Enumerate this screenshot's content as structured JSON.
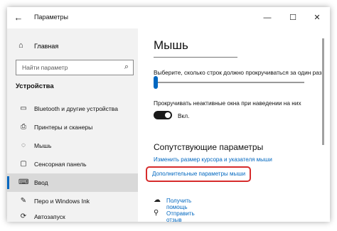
{
  "window": {
    "title": "Параметры",
    "controls": {
      "minimize": "—",
      "maximize": "☐",
      "close": "✕"
    }
  },
  "sidebar": {
    "home_label": "Главная",
    "search_placeholder": "Найти параметр",
    "section_title": "Устройства",
    "items": [
      {
        "label": "Bluetooth и другие устройства",
        "icon": "bluetooth-icon",
        "glyph": "▭"
      },
      {
        "label": "Принтеры и сканеры",
        "icon": "printer-icon",
        "glyph": "⎙"
      },
      {
        "label": "Мышь",
        "icon": "mouse-icon",
        "glyph": "◌"
      },
      {
        "label": "Сенсорная панель",
        "icon": "touchpad-icon",
        "glyph": "▢"
      },
      {
        "label": "Ввод",
        "icon": "keyboard-icon",
        "glyph": "⌨"
      },
      {
        "label": "Перо и Windows Ink",
        "icon": "pen-icon",
        "glyph": "✎"
      },
      {
        "label": "Автозапуск",
        "icon": "autoplay-icon",
        "glyph": "⟳"
      }
    ],
    "active_item": "Ввод"
  },
  "main": {
    "heading": "Мышь",
    "scroll_lines_label": "Выберите, сколько строк должно прокручиваться за один раз",
    "scroll_lines_value": 1,
    "inactive_scroll_label": "Прокручивать неактивные окна при наведении на них",
    "inactive_scroll_state": "Вкл.",
    "related_heading": "Сопутствующие параметры",
    "link_cursor": "Изменить размер курсора и указателя мыши",
    "link_additional": "Дополнительные параметры мыши",
    "help_label": "Получить помощь",
    "feedback_label": "Отправить отзыв"
  },
  "colors": {
    "accent": "#0067c0",
    "highlight": "#d62c2c",
    "sidebar_bg": "#f2f2f2"
  }
}
